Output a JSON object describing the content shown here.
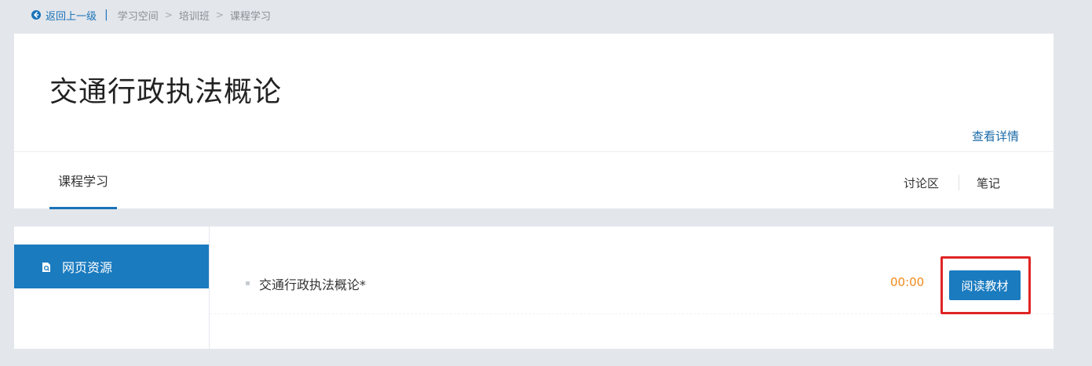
{
  "breadcrumb": {
    "back_label": "返回上一级",
    "separator": "|",
    "items": [
      "学习空间",
      "培训班",
      "课程学习"
    ],
    "arrow": ">"
  },
  "header": {
    "title": "交通行政执法概论",
    "detail_link": "查看详情"
  },
  "tabs": {
    "main": "课程学习",
    "discussion": "讨论区",
    "notes": "笔记"
  },
  "sidebar": {
    "active_item": {
      "label": "网页资源",
      "icon": "document-icon"
    }
  },
  "resource": {
    "name": "交通行政执法概论*",
    "time": "00:00",
    "action_label": "阅读教材"
  },
  "colors": {
    "accent": "#1a7bbf",
    "time": "#f08a1c",
    "highlight": "#e02424",
    "background": "#e3e6eb"
  }
}
